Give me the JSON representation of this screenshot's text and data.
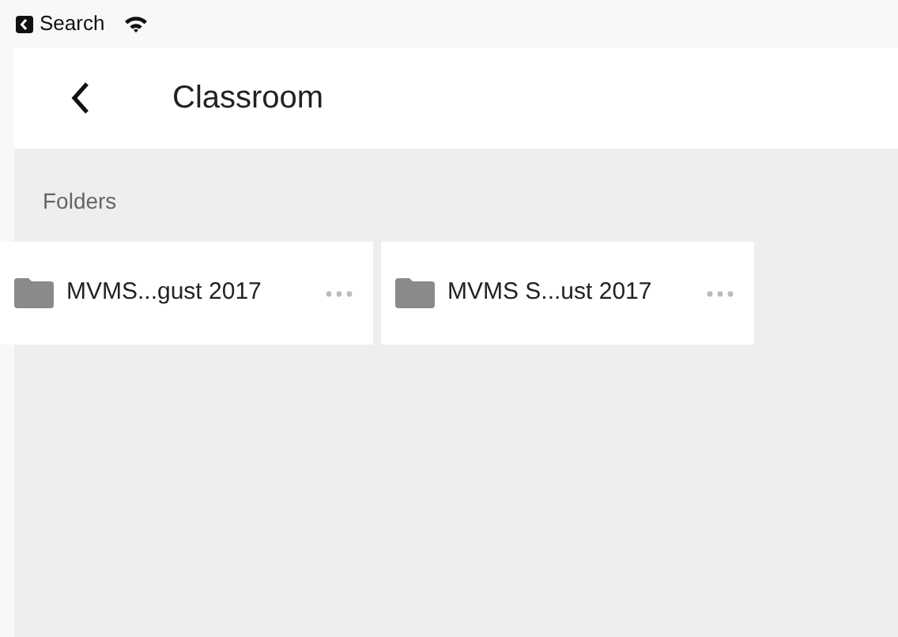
{
  "status_bar": {
    "back_label": "Search"
  },
  "header": {
    "title": "Classroom"
  },
  "section": {
    "title": "Folders"
  },
  "folders": [
    {
      "name": "MVMS...gust 2017"
    },
    {
      "name": "MVMS S...ust 2017"
    }
  ]
}
